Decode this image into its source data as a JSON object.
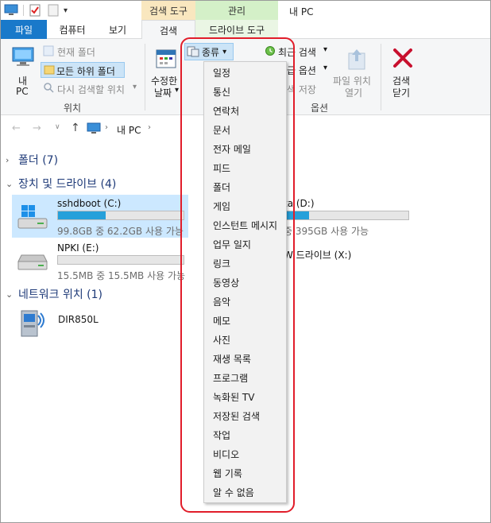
{
  "window": {
    "title": "내 PC"
  },
  "contextual_tabs": {
    "search_tools": "검색 도구",
    "manage": "관리"
  },
  "tabs": {
    "file": "파일",
    "computer": "컴퓨터",
    "view": "보기",
    "search": "검색",
    "drive_tools": "드라이브 도구"
  },
  "ribbon": {
    "location": {
      "this_pc_line1": "내",
      "this_pc_line2": "PC",
      "current_folder": "현재 폴더",
      "all_subfolders": "모든 하위 폴더",
      "search_again": "다시 검색할 위치",
      "group": "위치"
    },
    "refine": {
      "date_line1": "수정한",
      "date_line2": "날짜",
      "type_button": "종류"
    },
    "options": {
      "recent": "최근 검색",
      "advanced": "고급 옵션",
      "save": "검색 저장",
      "open_location_line1": "파일 위치",
      "open_location_line2": "열기",
      "group": "옵션"
    },
    "close": {
      "line1": "검색",
      "line2": "닫기"
    }
  },
  "address": {
    "path": "내 PC"
  },
  "sections": {
    "folders": "폴더 (7)",
    "devices": "장치 및 드라이브 (4)",
    "network": "네트워크 위치 (1)"
  },
  "drives": [
    {
      "name": "sshdboot (C:)",
      "size": "99.8GB 중 62.2GB 사용 가능",
      "used_fraction": 0.38
    },
    {
      "name": "ta (D:)",
      "size": "중 395GB 사용 가능",
      "used_fraction": 0.2
    },
    {
      "name": "NPKI (E:)",
      "size": "15.5MB 중 15.5MB 사용 가능",
      "used_fraction": 0.0
    },
    {
      "name": "W 드라이브 (X:)"
    }
  ],
  "network": [
    {
      "name": "DIR850L"
    }
  ],
  "type_menu": [
    "일정",
    "통신",
    "연락처",
    "문서",
    "전자 메일",
    "피드",
    "폴더",
    "게임",
    "인스턴트 메시지",
    "업무 일지",
    "링크",
    "동영상",
    "음악",
    "메모",
    "사진",
    "재생 목록",
    "프로그램",
    "녹화된 TV",
    "저장된 검색",
    "작업",
    "비디오",
    "웹 기록",
    "알 수 없음"
  ],
  "colors": {
    "accent": "#1979ca",
    "highlight": "#e11d2a",
    "drive_fill": "#26a0da"
  }
}
